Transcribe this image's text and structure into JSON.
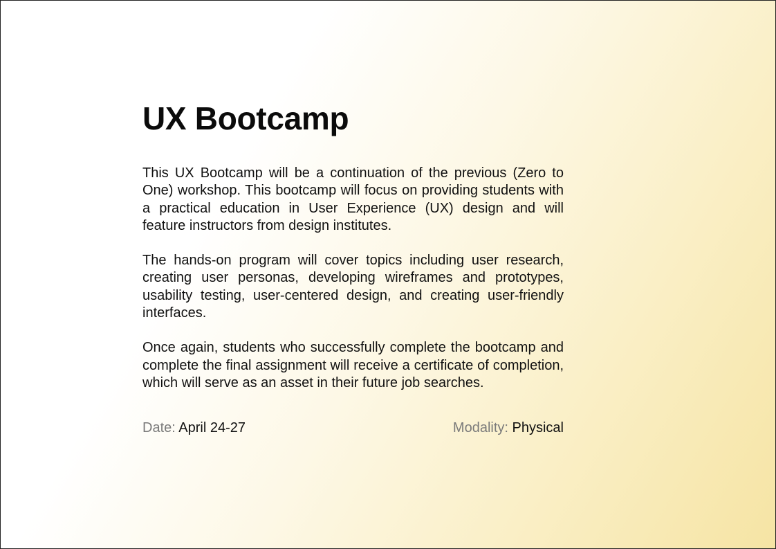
{
  "card": {
    "title": "UX Bootcamp",
    "paragraphs": [
      "This UX Bootcamp will be a continuation of the previous (Zero to One) workshop. This bootcamp will focus on providing students with a practical education in User Experience (UX) design and will feature instructors from design institutes.",
      "The hands-on program will cover topics including user research, creating user personas, developing wireframes and prototypes, usability testing, user-centered design, and creating user-friendly interfaces.",
      "Once again, students who successfully complete the bootcamp and complete the final assignment will receive a certificate of completion, which will serve as an asset in their future job searches."
    ],
    "date": {
      "label": "Date:",
      "value": "April 24-27"
    },
    "modality": {
      "label": "Modality:",
      "value": "Physical"
    }
  },
  "colors": {
    "gradient_start": "#ffffff",
    "gradient_end": "#f6e4a4",
    "label_gray": "#7a7a7a",
    "text": "#111111"
  }
}
